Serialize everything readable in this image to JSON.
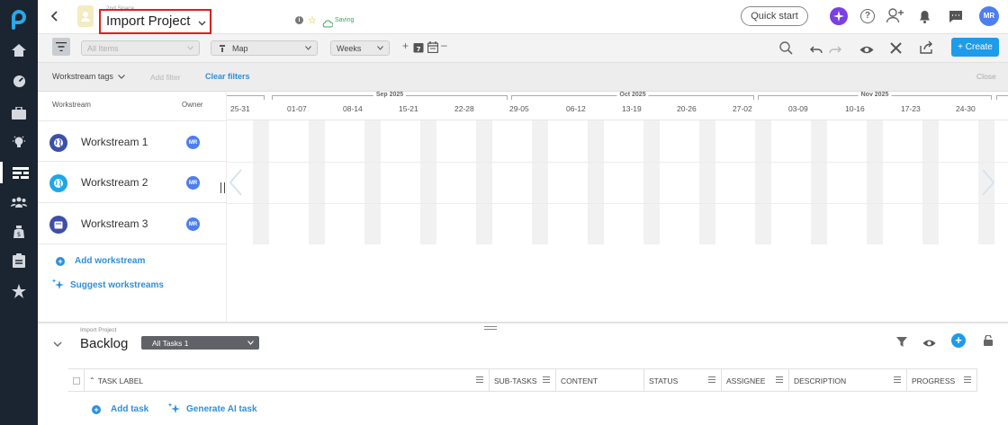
{
  "header": {
    "space_name": "2nd Space",
    "project_title": "Import Project",
    "saving_status": "Saving",
    "quick_start_label": "Quick start",
    "user_initials": "MR",
    "create_label": "+ Create"
  },
  "filters": {
    "items_select": "All Items",
    "view_select": "Map",
    "scale_select": "Weeks",
    "workstream_tags_label": "Workstream tags",
    "add_filter_label": "Add filter",
    "clear_filters_label": "Clear filters",
    "close_label": "Close"
  },
  "workstreams": {
    "col_workstream": "Workstream",
    "col_owner": "Owner",
    "items": [
      {
        "name": "Workstream 1",
        "owner": "MR",
        "icon": "globe-icon",
        "color": "#3d4fa8"
      },
      {
        "name": "Workstream 2",
        "owner": "MR",
        "icon": "globe-icon",
        "color": "#1ea7e6"
      },
      {
        "name": "Workstream 3",
        "owner": "MR",
        "icon": "calendar-icon",
        "color": "#3d4fa8"
      }
    ],
    "add_label": "Add workstream",
    "suggest_label": "Suggest workstreams"
  },
  "timeline": {
    "months": [
      "Sep 2025",
      "Oct 2025",
      "Nov 2025"
    ],
    "weeks": [
      "25-31",
      "01-07",
      "08-14",
      "15-21",
      "22-28",
      "29-05",
      "06-12",
      "13-19",
      "20-26",
      "27-02",
      "03-09",
      "10-16",
      "17-23",
      "24-30"
    ]
  },
  "backlog": {
    "breadcrumb": "Import Project",
    "title": "Backlog",
    "tasks_select": "All Tasks 1",
    "columns": [
      "Task Label",
      "Sub-Tasks",
      "Content",
      "Status",
      "Assignee",
      "Description",
      "Progress"
    ],
    "add_task_label": "Add task",
    "generate_ai_label": "Generate AI task"
  },
  "colors": {
    "nav_bg": "#1b2431",
    "accent_blue": "#2e8fd8",
    "create_button": "#1e9be9",
    "ai_purple": "#7b3fe4",
    "highlight_red": "#d9211b"
  }
}
